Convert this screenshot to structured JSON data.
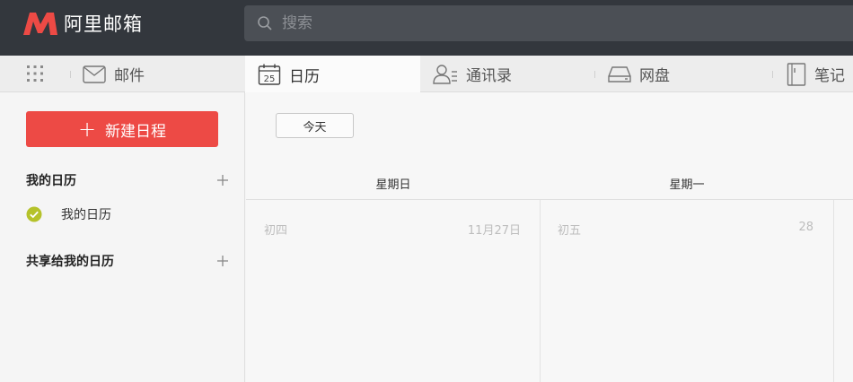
{
  "brand": {
    "name": "阿里邮箱",
    "color": "#ed4a45"
  },
  "search": {
    "placeholder": "搜索"
  },
  "nav": {
    "items": [
      {
        "label": "邮件",
        "icon": "mail-icon"
      },
      {
        "label": "日历",
        "icon": "calendar-icon",
        "icon_text": "25",
        "active": true
      },
      {
        "label": "通讯录",
        "icon": "contacts-icon"
      },
      {
        "label": "网盘",
        "icon": "drive-icon"
      },
      {
        "label": "笔记",
        "icon": "notes-icon"
      }
    ]
  },
  "sidebar": {
    "new_button_label": "新建日程",
    "my_calendars_title": "我的日历",
    "my_calendars": [
      {
        "label": "我的日历",
        "checked": true,
        "color": "#b5c22a"
      }
    ],
    "shared_title": "共享给我的日历"
  },
  "main": {
    "today_label": "今天",
    "days": [
      {
        "weekday": "星期日",
        "lunar": "初四",
        "date": "11月27日"
      },
      {
        "weekday": "星期一",
        "lunar": "初五",
        "date": "28"
      }
    ]
  }
}
